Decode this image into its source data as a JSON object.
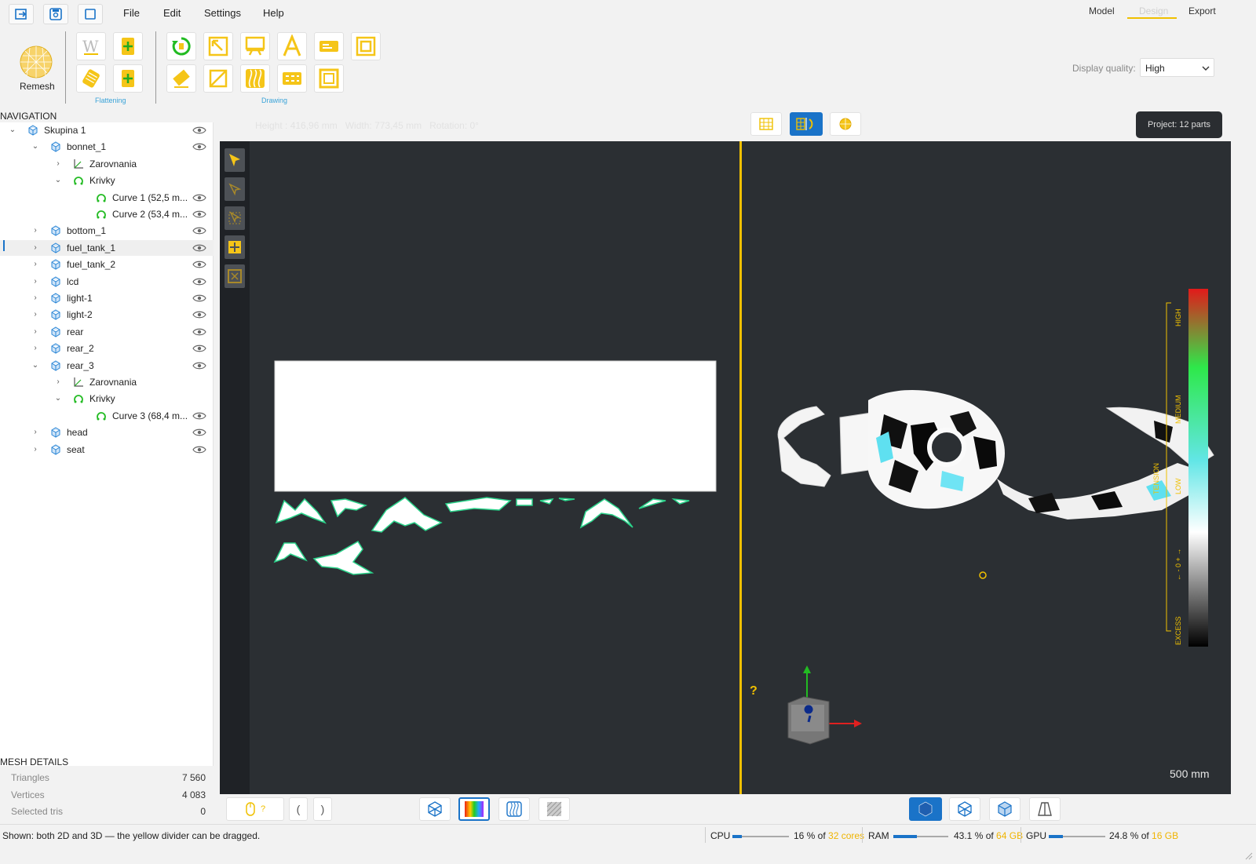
{
  "menu": {
    "file": "File",
    "edit": "Edit",
    "settings": "Settings",
    "help": "Help"
  },
  "mode_tabs": {
    "model": "Model",
    "design": "Design",
    "export": "Export",
    "active": "Design"
  },
  "toolbar": {
    "remesh_label": "Remesh",
    "flattening_group": "Flattening",
    "drawing_group": "Drawing"
  },
  "display_quality": {
    "label": "Display quality:",
    "value": "High"
  },
  "info_bar": {
    "height": "Height : 416,96 mm",
    "width": "Width: 773,45 mm",
    "rotation": "Rotation: 0°"
  },
  "project_badge": "Project: 12 parts",
  "navigation": {
    "title": "NAVIGATION",
    "items": [
      {
        "label": "Skupina 1",
        "depth": 0,
        "expanded": true,
        "icon": "cube-icon",
        "eye": true
      },
      {
        "label": "bonnet_1",
        "depth": 1,
        "expanded": true,
        "icon": "cube-icon",
        "eye": true
      },
      {
        "label": "Zarovnania",
        "depth": 2,
        "expanded": false,
        "icon": "axes-icon",
        "eye": false
      },
      {
        "label": "Krivky",
        "depth": 2,
        "expanded": true,
        "icon": "curve-icon",
        "eye": false
      },
      {
        "label": "Curve 1  (52,5 m...",
        "depth": 3,
        "expanded": null,
        "icon": "curve-icon",
        "eye": true
      },
      {
        "label": "Curve 2  (53,4 m...",
        "depth": 3,
        "expanded": null,
        "icon": "curve-icon",
        "eye": true
      },
      {
        "label": "bottom_1",
        "depth": 1,
        "expanded": false,
        "icon": "cube-icon",
        "eye": true
      },
      {
        "label": "fuel_tank_1",
        "depth": 1,
        "expanded": false,
        "icon": "cube-icon",
        "eye": true,
        "selected": true
      },
      {
        "label": "fuel_tank_2",
        "depth": 1,
        "expanded": false,
        "icon": "cube-icon",
        "eye": true
      },
      {
        "label": "lcd",
        "depth": 1,
        "expanded": false,
        "icon": "cube-icon",
        "eye": true
      },
      {
        "label": "light-1",
        "depth": 1,
        "expanded": false,
        "icon": "cube-icon",
        "eye": true
      },
      {
        "label": "light-2",
        "depth": 1,
        "expanded": false,
        "icon": "cube-icon",
        "eye": true
      },
      {
        "label": "rear",
        "depth": 1,
        "expanded": false,
        "icon": "cube-icon",
        "eye": true
      },
      {
        "label": "rear_2",
        "depth": 1,
        "expanded": false,
        "icon": "cube-icon",
        "eye": true
      },
      {
        "label": "rear_3",
        "depth": 1,
        "expanded": true,
        "icon": "cube-icon",
        "eye": true
      },
      {
        "label": "Zarovnania",
        "depth": 2,
        "expanded": false,
        "icon": "axes-icon",
        "eye": false
      },
      {
        "label": "Krivky",
        "depth": 2,
        "expanded": true,
        "icon": "curve-icon",
        "eye": false
      },
      {
        "label": "Curve 3  (68,4 m...",
        "depth": 3,
        "expanded": null,
        "icon": "curve-icon",
        "eye": true
      },
      {
        "label": "head",
        "depth": 1,
        "expanded": false,
        "icon": "cube-icon",
        "eye": true
      },
      {
        "label": "seat",
        "depth": 1,
        "expanded": false,
        "icon": "cube-icon",
        "eye": true
      }
    ]
  },
  "mesh_details": {
    "title": "MESH DETAILS",
    "rows": [
      {
        "key": "Triangles",
        "value": "7 560"
      },
      {
        "key": "Vertices",
        "value": "4 083"
      },
      {
        "key": "Selected tris",
        "value": "0"
      }
    ]
  },
  "viewport": {
    "help_glyph": "?",
    "scale_label": "500 mm",
    "legend": {
      "high": "HIGH",
      "medium": "MEDIUM",
      "tension": "TENSION",
      "low": "LOW",
      "zero": "← - 0 + →",
      "excess": "EXCESS"
    }
  },
  "bottom_toolbar": {
    "mouse_hint": "?",
    "paren_left": "(",
    "paren_right": ")"
  },
  "status": {
    "message": "Shown: both 2D and 3D — the yellow divider can be dragged.",
    "cpu_label": "CPU",
    "cpu_value": "16 % of ",
    "cpu_total": "32 cores",
    "cpu_fraction": 0.16,
    "ram_label": "RAM",
    "ram_value": "43.1 % of ",
    "ram_total": "64 GB",
    "ram_fraction": 0.431,
    "gpu_label": "GPU",
    "gpu_value": "24.8 % of ",
    "gpu_total": "16 GB",
    "gpu_fraction": 0.248
  },
  "colors": {
    "accent_yellow": "#f0c000",
    "accent_blue": "#1a73c8",
    "tool_green": "#22bb22",
    "viewport_bg": "#2b2f33"
  }
}
